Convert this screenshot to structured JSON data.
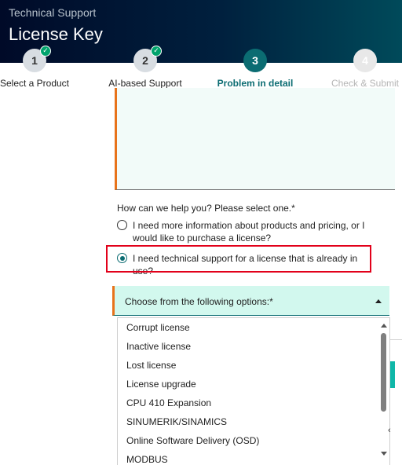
{
  "header": {
    "subtitle": "Technical Support",
    "title": "License Key"
  },
  "stepper": {
    "steps": [
      {
        "number": "1",
        "label": "Select a Product",
        "state": "done"
      },
      {
        "number": "2",
        "label": "AI-based Support",
        "state": "done"
      },
      {
        "number": "3",
        "label": "Problem in detail",
        "state": "active"
      },
      {
        "number": "4",
        "label": "Check & Submit",
        "state": "todo"
      }
    ],
    "check_glyph": "✓"
  },
  "form": {
    "question": "How can we help you? Please select one.*",
    "option_info": "I need more information about products and pricing, or I would like to purchase a license?",
    "option_support": "I need technical support for a license that is already in use?",
    "selected_option": "option_support",
    "dropdown_label": "Choose from the following options:*",
    "dropdown_options": [
      "Corrupt license",
      "Inactive license",
      "Lost license",
      "License upgrade",
      "CPU 410 Expansion",
      "SINUMERIK/SINAMICS",
      "Online Software Delivery (OSD)",
      "MODBUS"
    ]
  },
  "side": {
    "chevron_glyph": "‹"
  },
  "colors": {
    "accent_teal": "#0b6c72",
    "required_orange": "#e8731a",
    "highlight_red": "#e2001a",
    "success_green": "#00a36c",
    "dropdown_bg": "#d2f8ee"
  }
}
